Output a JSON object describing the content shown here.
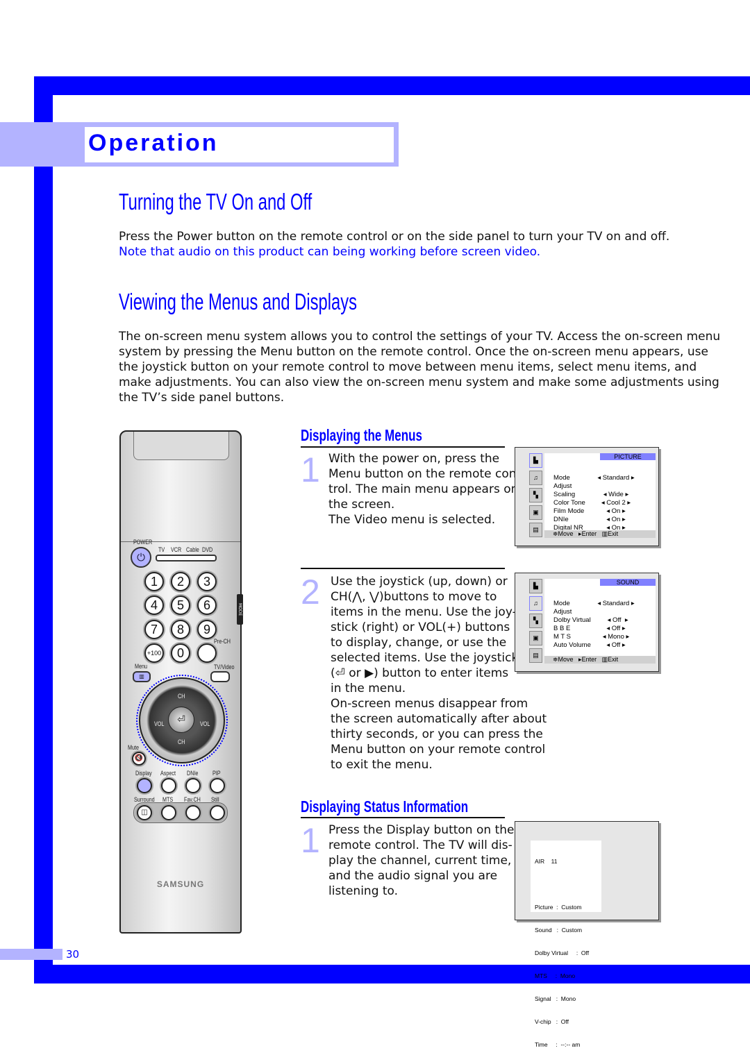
{
  "header": {
    "section_title": "Operation",
    "accent_color": "#0000ff",
    "band_color": "#b3b3ff"
  },
  "section1": {
    "title": "Turning the TV On and Off",
    "body": "Press the Power button on the remote control or on the side panel to turn your TV on and off.",
    "note": "Note that audio on this product can being working before screen video."
  },
  "section2": {
    "title": "Viewing the Menus and Displays",
    "body_lines": [
      "The on-screen menu system allows you to control the settings of your TV. Access the on-screen menu",
      "system by pressing the Menu button on the remote control. Once the on-screen menu appears, use",
      "the joystick button on your remote control to move between menu items, select menu items, and",
      "make adjustments. You can also view the on-screen menu system and make some adjustments using",
      "the TV’s side panel buttons."
    ]
  },
  "displaying_menus": {
    "title": "Displaying the Menus",
    "steps": [
      {
        "num": "1",
        "lines": [
          "With the power on, press the",
          "Menu button on the remote con-",
          "trol. The main menu appears on",
          "the screen.",
          "The Video menu is selected."
        ]
      },
      {
        "num": "2",
        "lines": [
          "Use the joystick (up, down) or",
          "CH(⋀, ⋁)buttons to move to",
          "items in the menu. Use the joy-",
          "stick (right) or VOL(+)  buttons",
          "to display, change, or use the",
          "selected items. Use the  joystick",
          "(⏎  or ▶) button to enter items",
          "in the menu.",
          "On-screen menus disappear from",
          "the screen automatically after about",
          "thirty seconds, or you can press the",
          "Menu button on your remote control",
          "to exit the menu."
        ]
      }
    ]
  },
  "picture_menu": {
    "title": "PICTURE",
    "rows": [
      {
        "label": "Mode",
        "value": "◂ Standard ▸"
      },
      {
        "label": "Adjust",
        "value": ""
      },
      {
        "label": "Scaling",
        "value": "◂   Wide   ▸"
      },
      {
        "label": "Color Tone",
        "value": "◂  Cool 2  ▸"
      },
      {
        "label": "Film Mode",
        "value": "◂    On    ▸"
      },
      {
        "label": "DNIe",
        "value": "◂    On    ▸"
      },
      {
        "label": "Digital NR",
        "value": "◂    On    ▸"
      }
    ],
    "footer": "≑Move   ▸Enter   ▥Exit"
  },
  "sound_menu": {
    "title": "SOUND",
    "rows": [
      {
        "label": "Mode",
        "value": "◂ Standard ▸"
      },
      {
        "label": "Adjust",
        "value": ""
      },
      {
        "label": "Dolby Virtual",
        "value": "  ◂ Off  ▸"
      },
      {
        "label": "B B E",
        "value": "◂   Off   ▸"
      },
      {
        "label": "M T S",
        "value": "◂  Mono  ▸"
      },
      {
        "label": "Auto Volume",
        "value": "◂   Off   ▸"
      }
    ],
    "footer": "≑Move   ▸Enter   ▥Exit"
  },
  "status_info": {
    "title": "Displaying Status Information",
    "step": {
      "num": "1",
      "lines": [
        "Press the Display button on the",
        "remote control. The TV will dis-",
        "play the channel, current time,",
        "and the audio signal you are",
        "listening to."
      ]
    },
    "screen_lines": [
      "AIR    11",
      "",
      "Picture  :  Custom",
      "Sound   :  Custom",
      "Dolby Virtual     :  Off",
      "MTS     :  Mono",
      "Signal   :  Mono",
      "V-chip   :  Off",
      "Time     :  --:-- am"
    ]
  },
  "remote": {
    "brand": "SAMSUNG",
    "power": "POWER",
    "modes": [
      "TV",
      "VCR",
      "Cable",
      "DVD"
    ],
    "mode_button": "MODE",
    "digits": [
      "1",
      "2",
      "3",
      "4",
      "5",
      "6",
      "7",
      "8",
      "9",
      "+100",
      "0"
    ],
    "prech": "Pre-CH",
    "menu": "Menu",
    "tvvideo": "TV/Video",
    "ch": "CH",
    "vol": "VOL",
    "mute": "Mute",
    "row1": [
      "Display",
      "Aspect",
      "DNIe",
      "PIP"
    ],
    "row2": [
      "Surround",
      "MTS",
      "Fav.CH",
      "Still"
    ]
  },
  "page_number": "30"
}
